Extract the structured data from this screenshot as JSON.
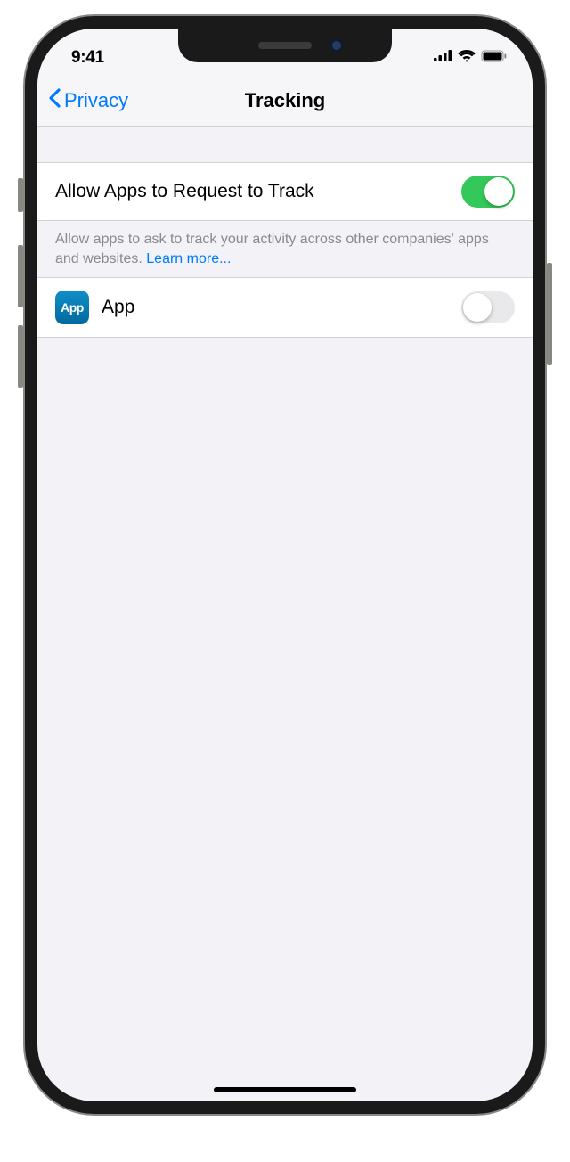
{
  "statusBar": {
    "time": "9:41"
  },
  "nav": {
    "back": "Privacy",
    "title": "Tracking"
  },
  "main": {
    "allowRow": {
      "label": "Allow Apps to Request to Track",
      "state": "on"
    },
    "footer": {
      "text": "Allow apps to ask to track your activity across other companies' apps and websites. ",
      "link": "Learn more..."
    },
    "apps": [
      {
        "iconLabel": "App",
        "name": "App",
        "state": "off"
      }
    ]
  }
}
